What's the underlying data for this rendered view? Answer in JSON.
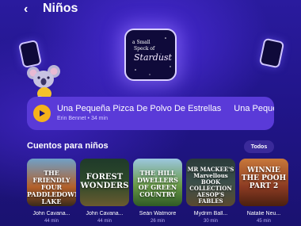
{
  "header": {
    "back_glyph": "‹",
    "title": "Niños"
  },
  "hero": {
    "cover_line1": "a Small",
    "cover_line2": "Speck of",
    "cover_line3": "Stardust"
  },
  "now_playing": {
    "title": "Una Pequeña Pizca De Polvo De Estrellas",
    "title_repeat": "Una Pequeñ",
    "author": "Erin Bennet",
    "separator": "•",
    "duration": "34 min"
  },
  "section": {
    "title": "Cuentos para niños",
    "see_all": "Todos"
  },
  "stories": [
    {
      "cover_text": "THE FRIENDLY FOUR PADDLEDOWN LAKE",
      "author": "John Cavana...",
      "duration": "44 min",
      "color": "#b4602a"
    },
    {
      "cover_text": "FOREST WONDERS",
      "author": "John Cavana...",
      "duration": "44 min",
      "color": "#2e4a2a"
    },
    {
      "cover_text": "THE HILL DWELLERS OF GREEN COUNTRY",
      "author": "Seán Watmore",
      "duration": "26 min",
      "color": "#4f7b3a"
    },
    {
      "cover_text": "MR MACKEE'S Marvellous BOOK COLLECTION AESOP'S FABLES",
      "author": "Mydrim Ball...",
      "duration": "30 min",
      "color": "#3b4f4a"
    },
    {
      "cover_text": "WINNIE THE POOH PART 2",
      "author": "Natalie Neu...",
      "duration": "45 min",
      "color": "#8a3a22"
    }
  ],
  "colors": {
    "background": "#21158a",
    "now_playing_bg": "#5a3ad8",
    "play_button": "#f5b21b",
    "see_all_bg": "#3a2a9a"
  }
}
